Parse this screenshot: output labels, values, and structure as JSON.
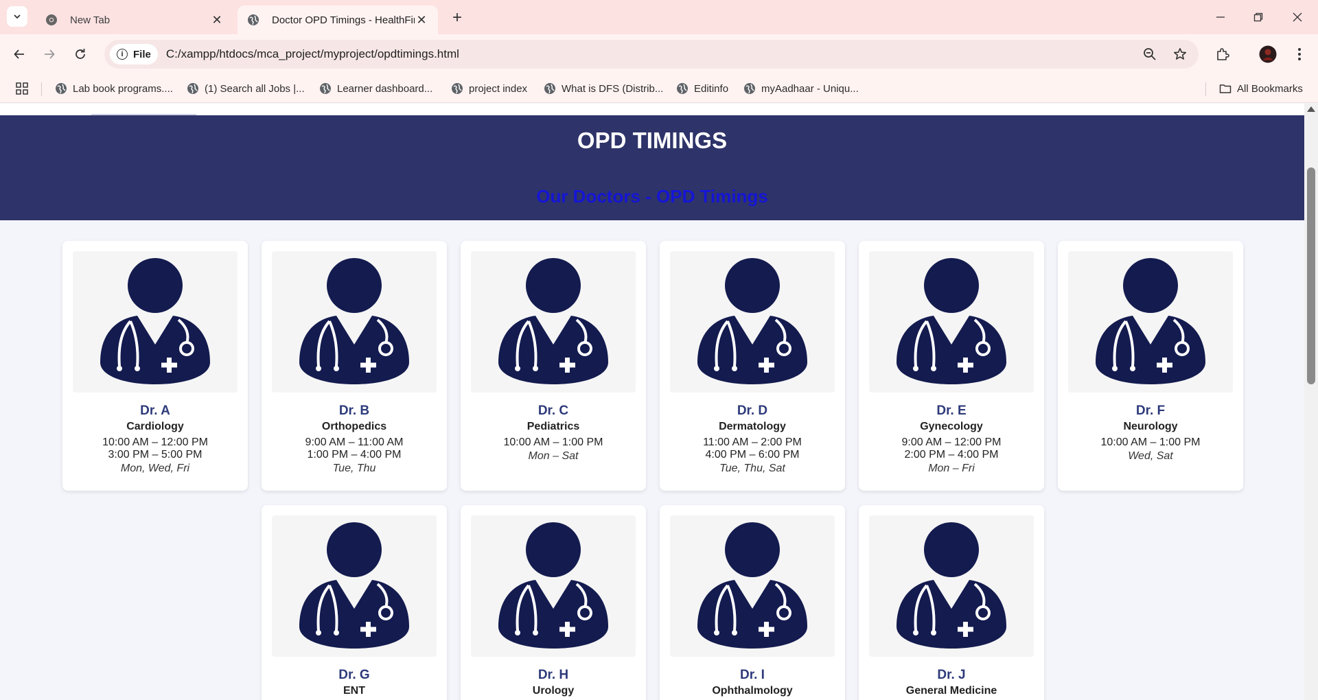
{
  "browser": {
    "tabs": [
      {
        "title": "New Tab",
        "active": false
      },
      {
        "title": "Doctor OPD Timings - HealthFirst",
        "active": true
      }
    ],
    "address": {
      "chip_label": "File",
      "url": "C:/xampp/htdocs/mca_project/myproject/opdtimings.html"
    },
    "bookmarks": [
      "Lab book programs....",
      "(1) Search all Jobs |...",
      "Learner dashboard...",
      "project index",
      "What is DFS (Distrib...",
      "Editinfo",
      "myAadhaar - Uniqu..."
    ],
    "all_bookmarks_label": "All Bookmarks"
  },
  "page": {
    "title": "OPD TIMINGS",
    "subtitle": "Our Doctors - OPD Timings",
    "doctors": [
      {
        "name": "Dr. A",
        "department": "Cardiology",
        "slots": [
          "10:00 AM – 12:00 PM",
          "3:00 PM – 5:00 PM"
        ],
        "days": "Mon, Wed, Fri"
      },
      {
        "name": "Dr. B",
        "department": "Orthopedics",
        "slots": [
          "9:00 AM – 11:00 AM",
          "1:00 PM – 4:00 PM"
        ],
        "days": "Tue, Thu"
      },
      {
        "name": "Dr. C",
        "department": "Pediatrics",
        "slots": [
          "10:00 AM – 1:00 PM"
        ],
        "days": "Mon – Sat"
      },
      {
        "name": "Dr. D",
        "department": "Dermatology",
        "slots": [
          "11:00 AM – 2:00 PM",
          "4:00 PM – 6:00 PM"
        ],
        "days": "Tue, Thu, Sat"
      },
      {
        "name": "Dr. E",
        "department": "Gynecology",
        "slots": [
          "9:00 AM – 12:00 PM",
          "2:00 PM – 4:00 PM"
        ],
        "days": "Mon – Fri"
      },
      {
        "name": "Dr. F",
        "department": "Neurology",
        "slots": [
          "10:00 AM – 1:00 PM"
        ],
        "days": "Wed, Sat"
      },
      {
        "name": "Dr. G",
        "department": "ENT"
      },
      {
        "name": "Dr. H",
        "department": "Urology"
      },
      {
        "name": "Dr. I",
        "department": "Ophthalmology"
      },
      {
        "name": "Dr. J",
        "department": "General Medicine"
      }
    ]
  },
  "colors": {
    "hero_bg": "#2e3469",
    "doctor_icon": "#131b4f",
    "subtitle": "#1515d6",
    "tabstrip_bg": "#fde2e2"
  },
  "icons": {
    "doctor": "doctor-avatar-icon",
    "bookmark": "globe-icon"
  }
}
